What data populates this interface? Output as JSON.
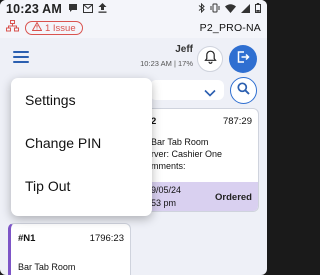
{
  "status_bar": {
    "time": "10:23 AM"
  },
  "app_bar": {
    "issue_label": "1 Issue",
    "terminal": "P2_PRO-NA"
  },
  "header": {
    "user_name": "Jeff",
    "time": "10:23 AM",
    "separator": "|",
    "battery": "17%"
  },
  "menu": {
    "items": [
      {
        "label": "Settings"
      },
      {
        "label": "Change PIN"
      },
      {
        "label": "Tip Out"
      }
    ]
  },
  "orders": [
    {
      "number": "2",
      "amount": "787:29",
      "line1": "Bar Tab Room",
      "line2": "rver: Cashier One",
      "line3": "mments:",
      "date": "9/05/24",
      "time": "53 pm",
      "status": "Ordered"
    },
    {
      "number": "#N1",
      "amount": "1796:23",
      "line1": "Bar Tab Room"
    }
  ],
  "colors": {
    "accent": "#2f6fd1",
    "alert": "#d9534f",
    "order_stripe": "#7d55c7",
    "order_footer": "#d9d0f0"
  }
}
